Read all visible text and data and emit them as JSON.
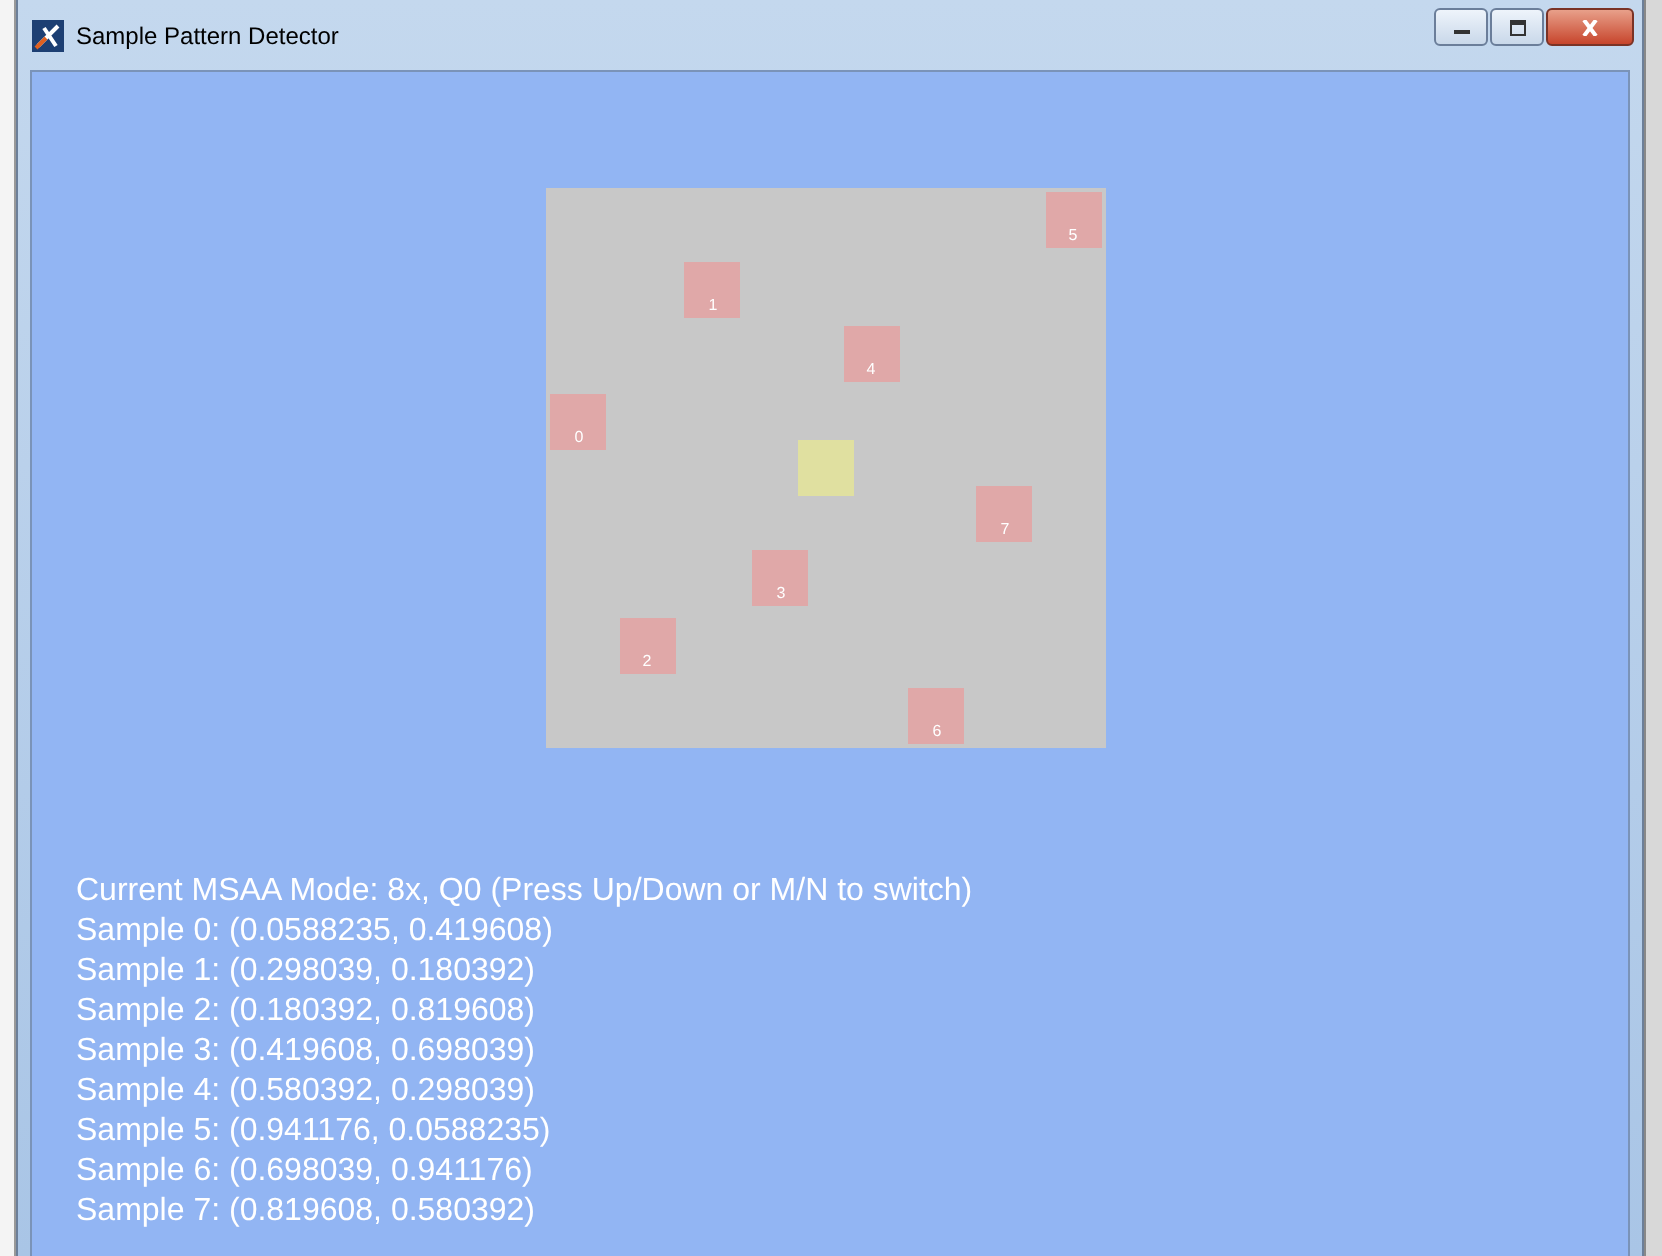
{
  "window": {
    "title": "Sample Pattern Detector"
  },
  "pattern": {
    "center_marker": true,
    "samples": [
      {
        "label": "0"
      },
      {
        "label": "1"
      },
      {
        "label": "2"
      },
      {
        "label": "3"
      },
      {
        "label": "4"
      },
      {
        "label": "5"
      },
      {
        "label": "6"
      },
      {
        "label": "7"
      }
    ]
  },
  "info_lines": [
    "Current MSAA Mode: 8x, Q0 (Press Up/Down or M/N to switch)",
    "Sample 0: (0.0588235, 0.419608)",
    "Sample 1: (0.298039, 0.180392)",
    "Sample 2: (0.180392, 0.819608)",
    "Sample 3: (0.419608, 0.698039)",
    "Sample 4: (0.580392, 0.298039)",
    "Sample 5: (0.941176, 0.0588235)",
    "Sample 6: (0.698039, 0.941176)",
    "Sample 7: (0.819608, 0.580392)"
  ]
}
